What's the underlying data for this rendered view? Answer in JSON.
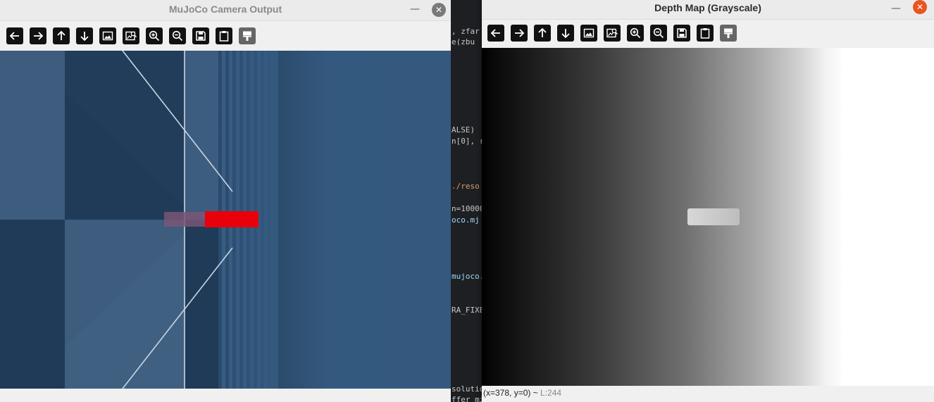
{
  "window_camera": {
    "title": "MuJoCo Camera Output",
    "close_glyph": "✕",
    "minimize_glyph": "—"
  },
  "window_depth": {
    "title": "Depth Map (Grayscale)",
    "close_glyph": "✕",
    "minimize_glyph": "—",
    "status_coords": "(x=378, y=0) ~ ",
    "status_value": "L:244"
  },
  "toolbar_icons": [
    "arrow-left-icon",
    "arrow-right-icon",
    "arrow-up-icon",
    "arrow-down-icon",
    "image-icon",
    "image-search-icon",
    "zoom-in-icon",
    "zoom-out-icon",
    "save-icon",
    "clipboard-icon",
    "paint-brush-icon"
  ],
  "editor_fragments": [
    ", zfar",
    "e(zbu",
    "ALSE)",
    "n[0], r",
    "./reso",
    "n=10000",
    "oco.mj",
    "mujoco.",
    "RA_FIXE",
    "solutio",
    "ffer mi"
  ],
  "colors": {
    "sky": "#34597f",
    "floor_dark": "#1e3a57",
    "floor_light": "#3f5f82",
    "red_box": "#e8000a",
    "close_button": "#e95420"
  }
}
